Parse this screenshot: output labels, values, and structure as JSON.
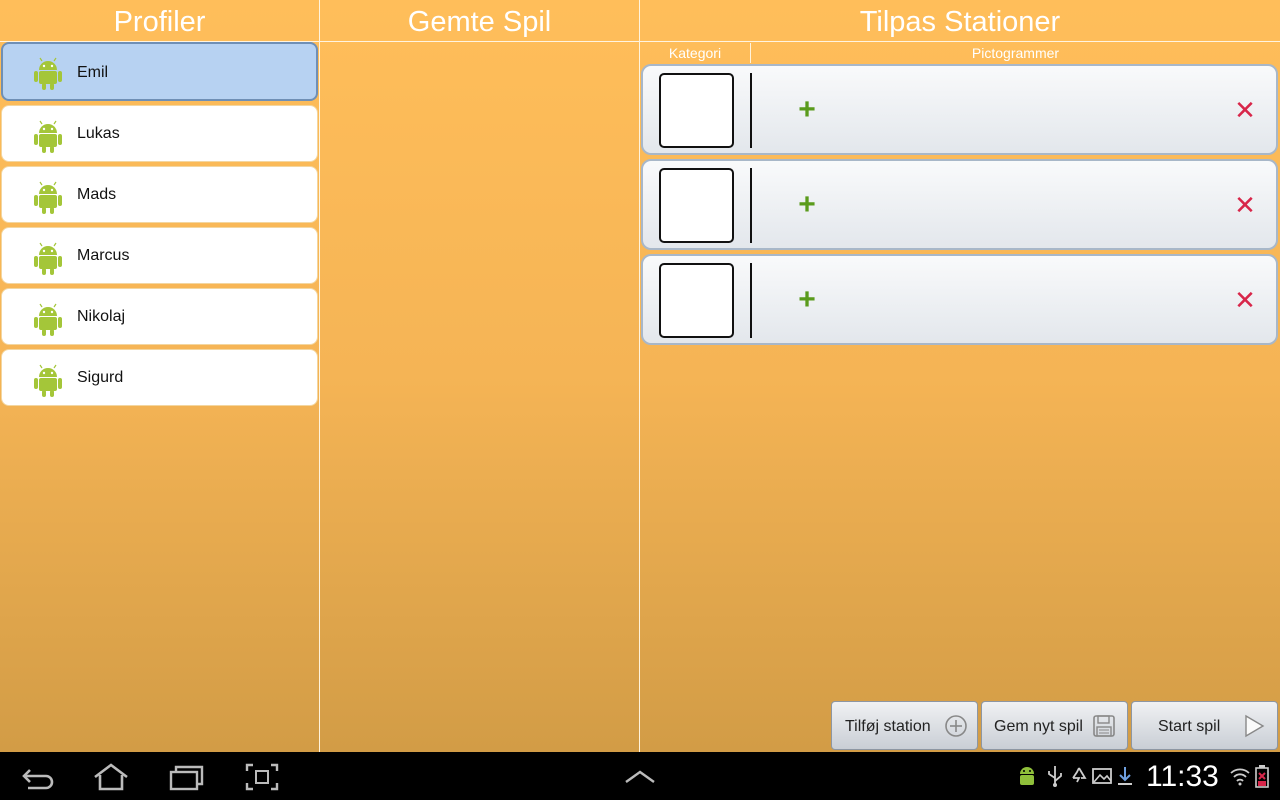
{
  "columns": {
    "profiles_title": "Profiler",
    "saved_games_title": "Gemte Spil",
    "stations_title": "Tilpas Stationer"
  },
  "stations_header": {
    "category": "Kategori",
    "pictograms": "Pictogrammer"
  },
  "profiles": [
    {
      "name": "Emil",
      "selected": true,
      "icon": "android-icon"
    },
    {
      "name": "Lukas",
      "selected": false,
      "icon": "android-icon"
    },
    {
      "name": "Mads",
      "selected": false,
      "icon": "android-icon"
    },
    {
      "name": "Marcus",
      "selected": false,
      "icon": "android-icon"
    },
    {
      "name": "Nikolaj",
      "selected": false,
      "icon": "android-icon"
    },
    {
      "name": "Sigurd",
      "selected": false,
      "icon": "android-icon"
    }
  ],
  "stations": [
    {
      "add_icon": "plus-icon",
      "remove_icon": "close-icon"
    },
    {
      "add_icon": "plus-icon",
      "remove_icon": "close-icon"
    },
    {
      "add_icon": "plus-icon",
      "remove_icon": "close-icon"
    }
  ],
  "buttons": {
    "add_station": "Tilføj station",
    "save_game": "Gem nyt spil",
    "start_game": "Start spil"
  },
  "status_bar": {
    "time": "11:33",
    "icons": [
      "android-debug-icon",
      "usb-icon",
      "recycle-icon",
      "gallery-icon",
      "download-icon",
      "wifi-icon",
      "battery-icon"
    ]
  },
  "navigation": {
    "icons": [
      "back-icon",
      "home-icon",
      "recent-apps-icon",
      "screenshot-icon",
      "expand-up-icon"
    ]
  },
  "colors": {
    "accent_plus": "#5a9b1c",
    "accent_close": "#d8264a",
    "selected_profile": "#b7d2f2",
    "background_top": "#ffbe5a",
    "background_bottom": "#d29c46"
  }
}
